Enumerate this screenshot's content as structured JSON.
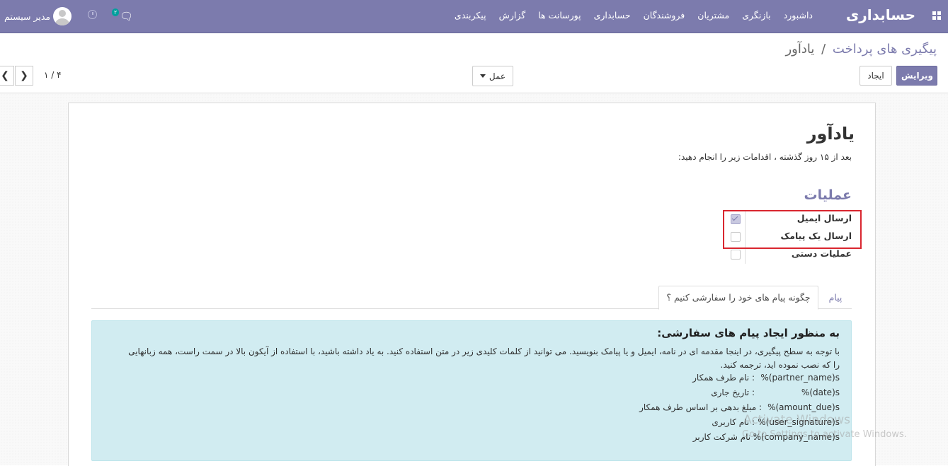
{
  "navbar": {
    "brand": "حسابداری",
    "menu": [
      "داشبورد",
      "بازنگری",
      "مشتریان",
      "فروشندگان",
      "حسابداری",
      "پورسانت ها",
      "گزارش",
      "پیکربندی"
    ],
    "user_name": "مدیر سیستم",
    "chat_badge": "۲",
    "bg_color": "#7c7bad"
  },
  "control_panel": {
    "breadcrumb_parent": "پیگیری های پرداخت",
    "breadcrumb_separator": "/",
    "breadcrumb_current": "یادآور",
    "edit_label": "ویرایش",
    "create_label": "ایجاد",
    "action_label": "عمل",
    "pager_value": "۱ / ۴"
  },
  "form": {
    "title": "یادآور",
    "description": "بعد از ۱۵ روز گذشته ، اقدامات زیر را انجام دهید:",
    "group_title": "عملیات",
    "fields": [
      {
        "label": "ارسال ایمیل",
        "checked": true
      },
      {
        "label": "ارسال یک پیامک",
        "checked": false
      },
      {
        "label": "عملیات دستی",
        "checked": false
      }
    ]
  },
  "tabs": [
    {
      "label": "پیام",
      "active": false
    },
    {
      "label": "چگونه پیام های خود را سفارشی کنیم ؟",
      "active": true
    }
  ],
  "help": {
    "title": "به منظور ایجاد پیام های سفارشی:",
    "body": "با توجه به سطح پیگیری، در اینجا مقدمه ای در نامه، ایمیل و یا پیامک بنویسید. می توانید از کلمات کلیدی زیر در متن استفاده کنید. به یاد داشته باشید، با استفاده از آیکون بالا در سمت راست، همه زبانهایی را که نصب نموده اید، ترجمه کنید.",
    "keywords": [
      {
        "code": "%(partner_name)s",
        "desc": ": نام طرف همکار"
      },
      {
        "code": "%(date)s",
        "desc": ": تاریخ جاری"
      },
      {
        "code": "%(amount_due)s",
        "desc": ": مبلغ بدهی بر اساس طرف همکار"
      },
      {
        "code": "%(user_signature)s",
        "desc": ": نام کاربری"
      },
      {
        "code": "%(company_name)s",
        "desc": ": نام شرکت کاربر"
      }
    ]
  },
  "watermark": {
    "line1": "Activate Windows",
    "line2": "Go to Settings to activate Windows."
  }
}
